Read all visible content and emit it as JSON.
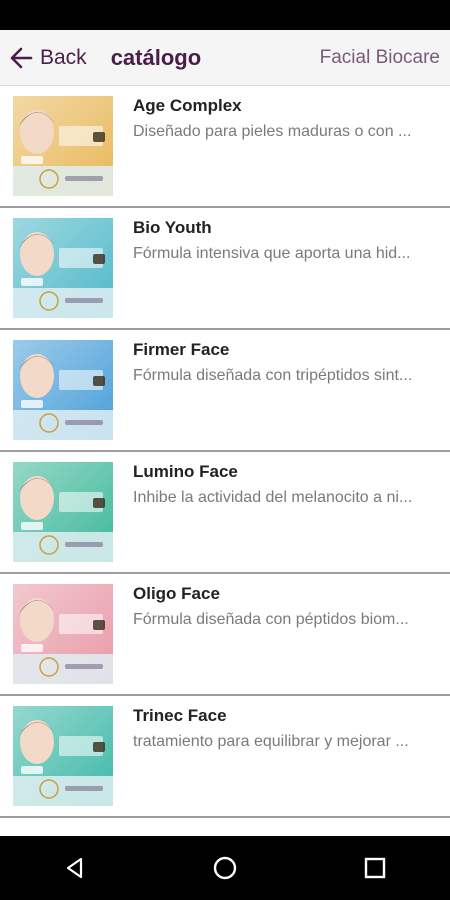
{
  "header": {
    "back_label": "Back",
    "title": "catálogo",
    "brand": "Facial Biocare",
    "accent_color": "#4a1d4a"
  },
  "products": [
    {
      "name": "Age Complex",
      "description": "Diseñado para pieles maduras o con ...",
      "thumb_tint": "#e8b85a",
      "thumb_icon": "age-complex-product-thumbnail"
    },
    {
      "name": "Bio Youth",
      "description": "Fórmula intensiva que aporta una hid...",
      "thumb_tint": "#4fb8c8",
      "thumb_icon": "bio-youth-product-thumbnail"
    },
    {
      "name": "Firmer Face",
      "description": "Fórmula diseñada con tripéptidos sint...",
      "thumb_tint": "#4a9fd8",
      "thumb_icon": "firmer-face-product-thumbnail"
    },
    {
      "name": "Lumino Face",
      "description": "Inhibe la actividad del melanocito a ni...",
      "thumb_tint": "#3fb89a",
      "thumb_icon": "lumino-face-product-thumbnail"
    },
    {
      "name": "Oligo Face",
      "description": "Fórmula diseñada con péptidos biom...",
      "thumb_tint": "#e89aa8",
      "thumb_icon": "oligo-face-product-thumbnail"
    },
    {
      "name": "Trinec Face",
      "description": "tratamiento para equilibrar y mejorar ...",
      "thumb_tint": "#3fb8a8",
      "thumb_icon": "trinec-face-product-thumbnail"
    }
  ],
  "nav": {
    "back_icon": "triangle-back-icon",
    "home_icon": "circle-home-icon",
    "recents_icon": "square-recents-icon"
  }
}
